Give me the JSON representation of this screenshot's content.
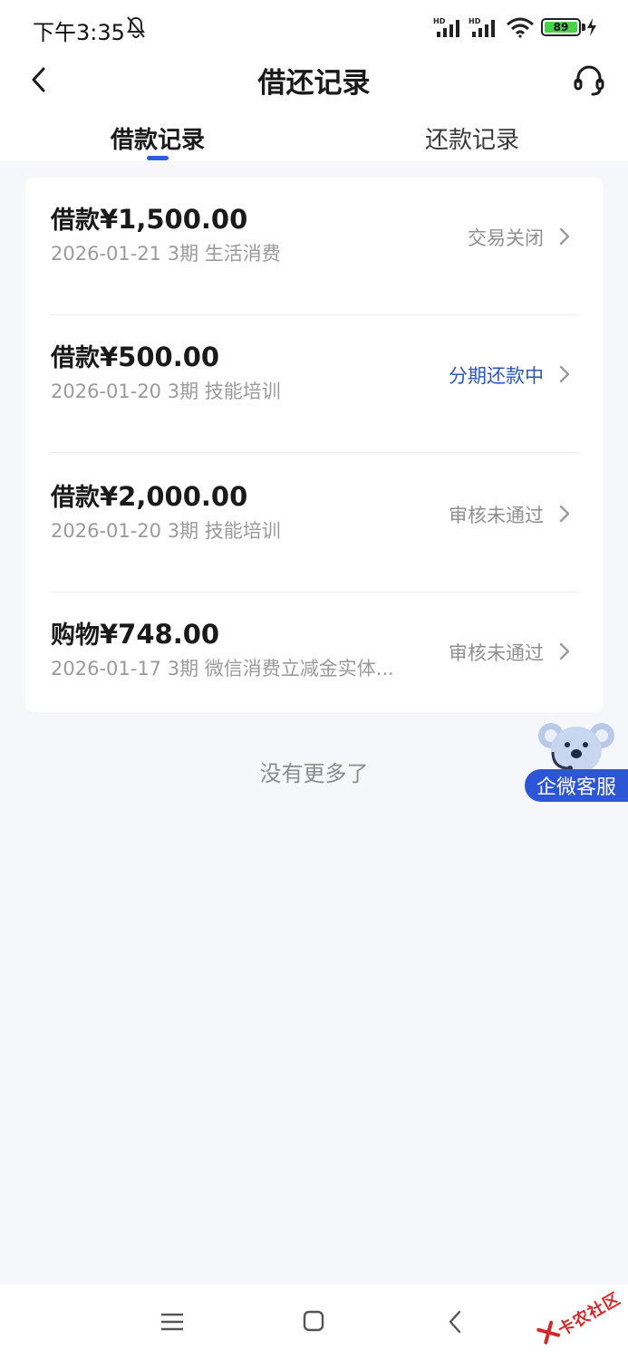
{
  "status_bar": {
    "time": "下午3:35",
    "battery": "89"
  },
  "header": {
    "title": "借还记录"
  },
  "tabs": [
    {
      "label": "借款记录",
      "active": true
    },
    {
      "label": "还款记录",
      "active": false
    }
  ],
  "records": [
    {
      "type": "借款",
      "amount": "¥1,500.00",
      "date": "2026-01-21",
      "term": "3期",
      "purpose": "生活消费",
      "status": "交易关闭"
    },
    {
      "type": "借款",
      "amount": "¥500.00",
      "date": "2026-01-20",
      "term": "3期",
      "purpose": "技能培训",
      "status": "分期还款中"
    },
    {
      "type": "借款",
      "amount": "¥2,000.00",
      "date": "2026-01-20",
      "term": "3期",
      "purpose": "技能培训",
      "status": "审核未通过"
    },
    {
      "type": "购物",
      "amount": "¥748.00",
      "date": "2026-01-17",
      "term": "3期",
      "purpose": "微信消费立减金实体...",
      "status": "审核未通过"
    }
  ],
  "footer_text": "没有更多了",
  "floating_service": {
    "label": "企微客服"
  },
  "watermark": "卡农社区",
  "colors": {
    "accent": "#2b5fd9",
    "active_status": "#2c56b8",
    "background": "#f6f7fb"
  },
  "icons": [
    "bell-off-icon",
    "signal-icon",
    "wifi-icon",
    "battery-icon",
    "charging-icon",
    "back-arrow-icon",
    "headset-icon",
    "chevron-right-icon",
    "koala-mascot-icon",
    "menu-icon",
    "home-icon",
    "system-back-icon"
  ]
}
